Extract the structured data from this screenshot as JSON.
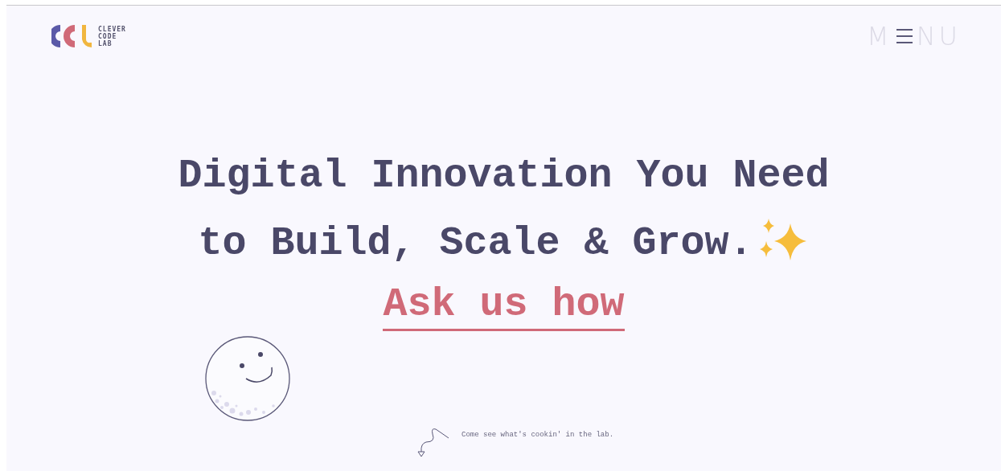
{
  "logo": {
    "lines": [
      "CLEVER",
      "CODE",
      "LAB"
    ]
  },
  "menu": {
    "left": "M",
    "right": "NU"
  },
  "hero": {
    "lines": [
      "Digital Innovation You Need",
      "to Build, Scale & Grow."
    ],
    "link": "Ask us how"
  },
  "caption": "Come see what's cookin' in the lab."
}
